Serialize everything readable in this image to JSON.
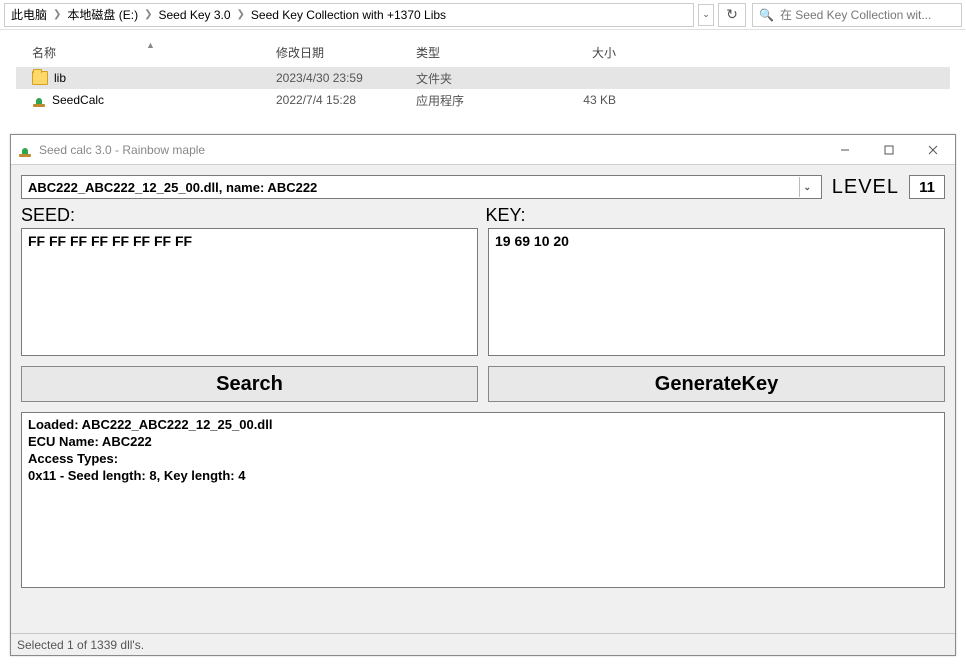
{
  "explorer": {
    "breadcrumb": [
      "此电脑",
      "本地磁盘 (E:)",
      "Seed Key 3.0",
      "Seed Key Collection with +1370 Libs"
    ],
    "search_placeholder": "在 Seed Key Collection wit...",
    "columns": {
      "name": "名称",
      "date": "修改日期",
      "type": "类型",
      "size": "大小"
    },
    "rows": [
      {
        "icon": "folder",
        "name": "lib",
        "date": "2023/4/30 23:59",
        "type": "文件夹",
        "size": "",
        "selected": true
      },
      {
        "icon": "app",
        "name": "SeedCalc",
        "date": "2022/7/4 15:28",
        "type": "应用程序",
        "size": "43 KB",
        "selected": false
      }
    ]
  },
  "app": {
    "title": "Seed calc 3.0 - Rainbow maple",
    "dll_text": "ABC222_ABC222_12_25_00.dll, name: ABC222",
    "level_label": "LEVEL",
    "level_value": "11",
    "seed_label": "SEED:",
    "key_label": "KEY:",
    "seed_value": "FF FF FF FF FF FF FF FF",
    "key_value": "19 69 10 20",
    "search_btn": "Search",
    "generate_btn": "GenerateKey",
    "log": "Loaded: ABC222_ABC222_12_25_00.dll\nECU Name: ABC222\nAccess Types:\n0x11 - Seed length: 8, Key length: 4",
    "status": "Selected 1 of 1339 dll's."
  }
}
